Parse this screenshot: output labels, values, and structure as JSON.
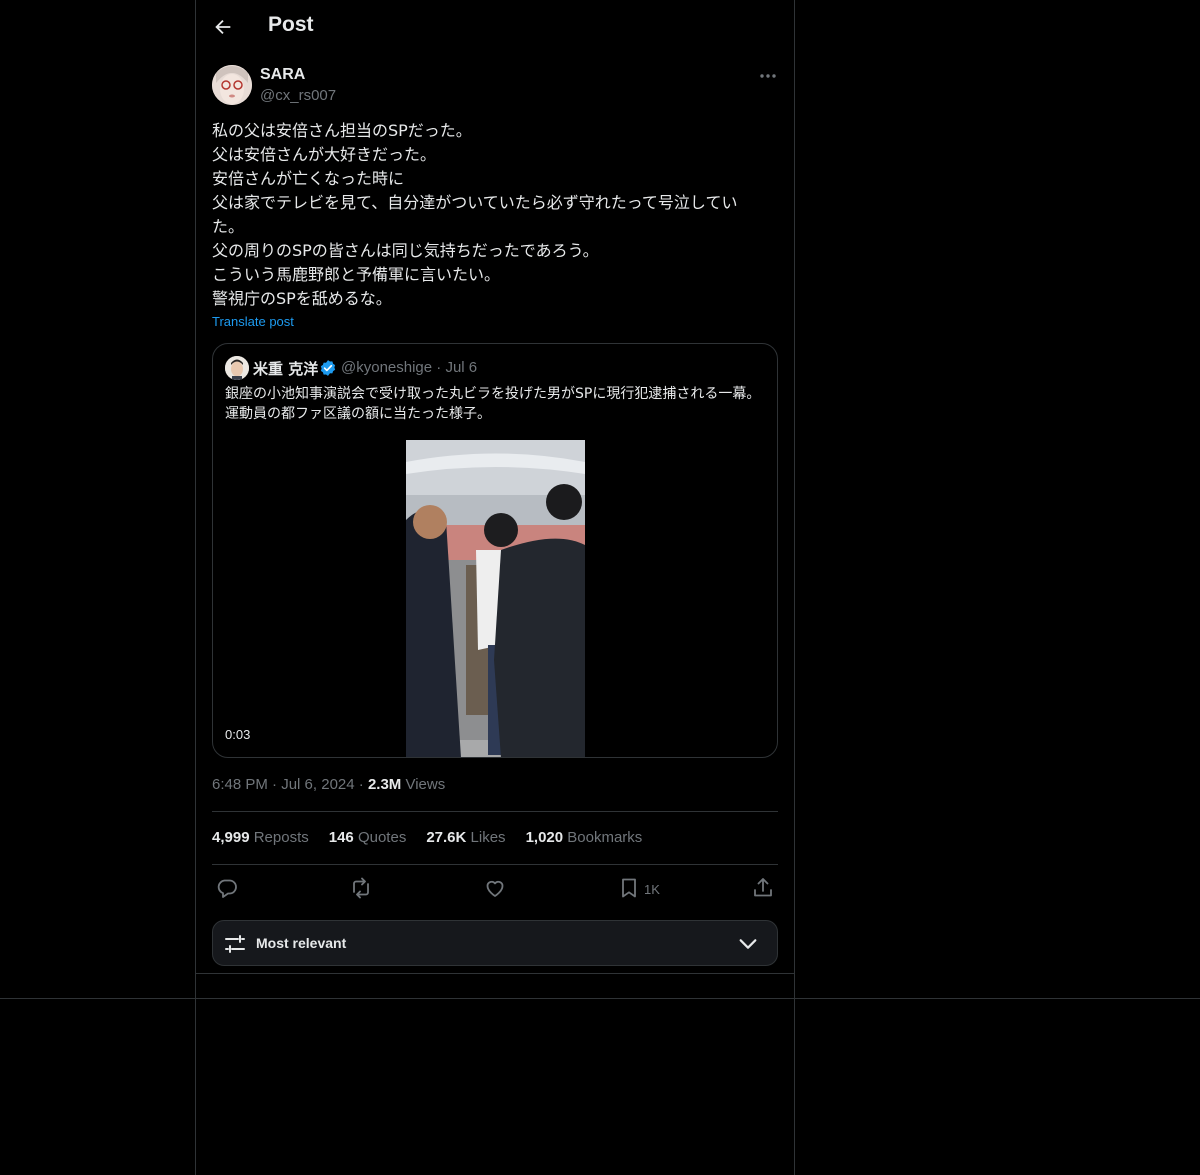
{
  "header": {
    "title": "Post"
  },
  "author": {
    "name": "SARA",
    "handle": "@cx_rs007"
  },
  "post": {
    "text": "私の父は安倍さん担当のSPだった。\n父は安倍さんが大好きだった。\n安倍さんが亡くなった時に\n父は家でテレビを見て、自分達がついていたら必ず守れたって号泣してい\nた。\n父の周りのSPの皆さんは同じ気持ちだったであろう。\nこういう馬鹿野郎と予備軍に言いたい。\n警視庁のSPを舐めるな。",
    "translate_label": "Translate post"
  },
  "quote": {
    "name": "米重 克洋",
    "handle_date": "@kyoneshige · Jul 6",
    "text": "銀座の小池知事演説会で受け取った丸ビラを投げた男がSPに現行犯逮捕される一幕。運動員の都ファ区議の額に当たった様子。",
    "video_duration": "0:03"
  },
  "meta": {
    "time": "6:48 PM",
    "date": "Jul 6, 2024",
    "views_count": "2.3M",
    "views_label": "Views"
  },
  "stats": {
    "reposts_count": "4,999",
    "reposts_label": "Reposts",
    "quotes_count": "146",
    "quotes_label": "Quotes",
    "likes_count": "27.6K",
    "likes_label": "Likes",
    "bookmarks_count": "1,020",
    "bookmarks_label": "Bookmarks"
  },
  "actions": {
    "bookmark_count": "1K",
    "icons": [
      "reply-icon",
      "repost-icon",
      "like-icon",
      "bookmark-icon",
      "share-icon"
    ]
  },
  "sort": {
    "label": "Most relevant"
  },
  "colors": {
    "background": "#000000",
    "border": "#2f3336",
    "muted": "#71767b",
    "accent": "#1d9bf0",
    "text": "#e7e9ea"
  }
}
